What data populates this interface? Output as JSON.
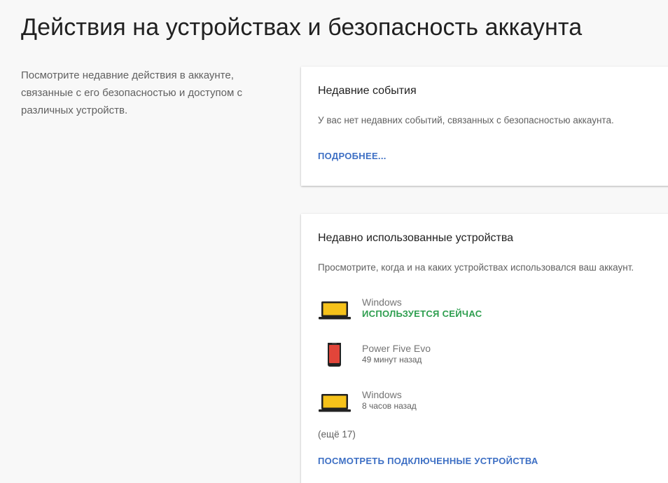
{
  "page": {
    "title": "Действия на устройствах и безопасность аккаунта",
    "intro": "Посмотрите недавние действия в аккаунте, связанные с его безопасностью и доступом с различных устройств."
  },
  "recent_events": {
    "title": "Недавние события",
    "description": "У вас нет недавних событий, связанных с безопасностью аккаунта.",
    "link": "ПОДРОБНЕЕ..."
  },
  "recent_devices": {
    "title": "Недавно использованные устройства",
    "description": "Просмотрите, когда и на каких устройствах использовался ваш аккаунт.",
    "devices": [
      {
        "name": "Windows",
        "status": "ИСПОЛЬЗУЕТСЯ СЕЙЧАС",
        "icon": "laptop-icon",
        "active": true
      },
      {
        "name": "Power Five Evo",
        "status": "49 минут назад",
        "icon": "phone-icon",
        "active": false
      },
      {
        "name": "Windows",
        "status": "8 часов назад",
        "icon": "laptop-icon",
        "active": false
      }
    ],
    "more": "(ещё 17)",
    "link": "ПОСМОТРЕТЬ ПОДКЛЮЧЕННЫЕ УСТРОЙСТВА"
  },
  "colors": {
    "link": "#3d6fc4",
    "active_status": "#2e9e4f",
    "laptop_screen": "#f6c21a",
    "phone_screen": "#e2453a"
  }
}
